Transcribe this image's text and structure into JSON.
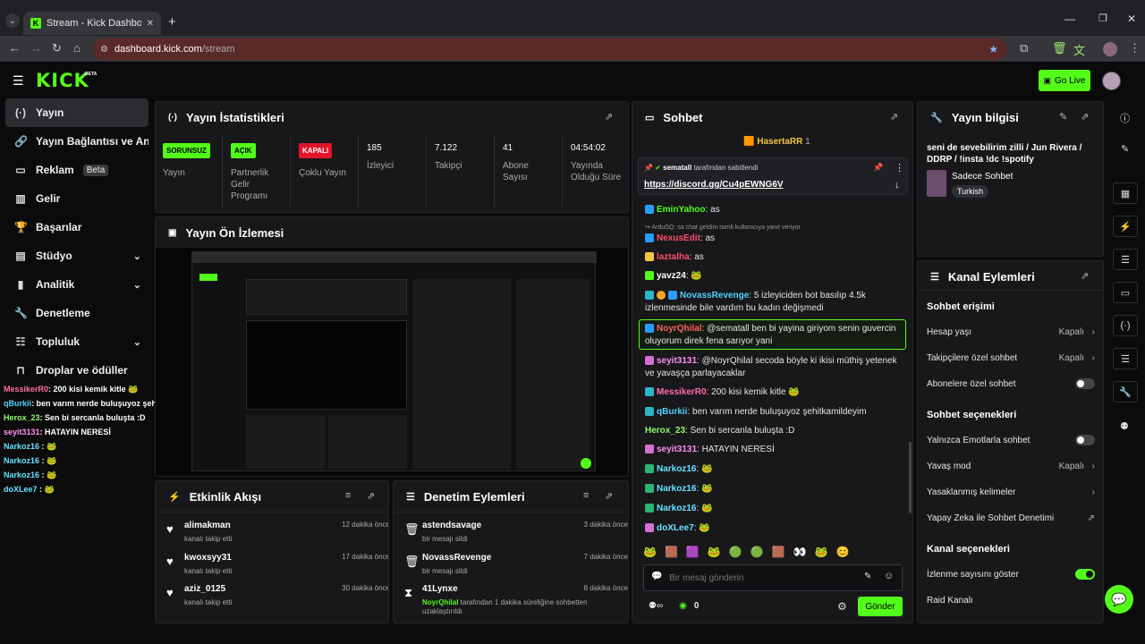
{
  "browser": {
    "tab_title": "Stream - Kick Dashboard",
    "url_domain": "dashboard.kick.com",
    "url_path": "/stream"
  },
  "header": {
    "logo": "KICK",
    "logo_beta": "BETA",
    "go_live": "Go Live"
  },
  "sidebar": {
    "items": [
      {
        "label": "Yayın",
        "icon": "broadcast-icon"
      },
      {
        "label": "Yayın Bağlantısı ve Anahtarı",
        "icon": "link-icon"
      },
      {
        "label": "Reklam",
        "icon": "ad-icon",
        "badge": "Beta"
      },
      {
        "label": "Gelir",
        "icon": "dollar-icon"
      },
      {
        "label": "Başarılar",
        "icon": "trophy-icon"
      },
      {
        "label": "Stüdyo",
        "icon": "studio-icon"
      },
      {
        "label": "Analitik",
        "icon": "chart-icon"
      },
      {
        "label": "Denetleme",
        "icon": "wrench-icon"
      },
      {
        "label": "Topluluk",
        "icon": "people-icon"
      },
      {
        "label": "Droplar ve ödüller",
        "icon": "gift-icon"
      }
    ]
  },
  "overlay_chat": [
    {
      "user": "MessikerR0",
      "text": ": 200 kisi kemik kitle",
      "color": "#ff6fa3"
    },
    {
      "user": "qBurkii",
      "text": ": ben varım nerde buluşuyoz şehitkamildeyim",
      "color": "#4fd1ff"
    },
    {
      "user": "Herox_23",
      "text": ": Sen bi sercanla buluşta :D",
      "color": "#8cff66"
    },
    {
      "user": "seyit3131",
      "text": ": HATAYIN NERESİ",
      "color": "#ff8ef0"
    },
    {
      "user": "Narkoz16",
      "text": " :",
      "color": "#66e0ff"
    },
    {
      "user": "Narkoz16",
      "text": " :",
      "color": "#66e0ff"
    },
    {
      "user": "Narkoz16",
      "text": " :",
      "color": "#66e0ff"
    },
    {
      "user": "doXLee7",
      "text": " :",
      "color": "#66e0ff"
    }
  ],
  "stats": {
    "title": "Yayın İstatistikleri",
    "cards": [
      {
        "badge": "SORUNSUZ",
        "label": "Yayın",
        "badge_color": "#53fc18"
      },
      {
        "badge": "AÇIK",
        "label": "Partnerlik Gelir Programı",
        "badge_color": "#53fc18"
      },
      {
        "badge": "KAPALI",
        "label": "Çoklu Yayın",
        "badge_color": "#e0142b"
      },
      {
        "value": "185",
        "label": "İzleyici"
      },
      {
        "value": "7.122",
        "label": "Takipçi"
      },
      {
        "value": "41",
        "label": "Abone Sayısı"
      },
      {
        "value": "04:54:02",
        "label": "Yayında Olduğu Süre"
      }
    ]
  },
  "preview": {
    "title": "Yayın Ön İzlemesi"
  },
  "activity": {
    "title": "Etkinlik Akışı",
    "items": [
      {
        "name": "alimakman",
        "sub": "kanalı takip etti",
        "time": "12 dakika önce"
      },
      {
        "name": "kwoxsyy31",
        "sub": "kanalı takip etti",
        "time": "17 dakika önce"
      },
      {
        "name": "aziz_0125",
        "sub": "kanalı takip etti",
        "time": "30 dakika önce"
      }
    ]
  },
  "moderation": {
    "title": "Denetim Eylemleri",
    "items": [
      {
        "name": "astendsavage",
        "sub": "bir mesajı sildi",
        "time": "3 dakika önce",
        "icon": "trash-icon"
      },
      {
        "name": "NovassRevenge",
        "sub": "bir mesajı sildi",
        "time": "7 dakika önce",
        "icon": "trash-icon"
      },
      {
        "name": "41Lynxe",
        "sub_user": "NoyrQhilal",
        "sub": " tarafından 1 dakika süreliğine sohbetten uzaklaştırıldı",
        "time": "8 dakika önce",
        "icon": "hourglass-icon"
      }
    ]
  },
  "chat": {
    "title": "Sohbet",
    "top_gifter": "HasertaRR",
    "top_gifter_count": "1",
    "pinned_by": "sematall",
    "pinned_suffix": " tarafından sabitlendi",
    "pinned_link": "https://discord.gg/Cu4pEWNG6V",
    "messages": [
      {
        "user": "EminYahoo",
        "text": ": as",
        "color": "#53fc18"
      },
      {
        "reply": "ArduSQ: sa chat geldim isimli kullanıcıya yanıt veriyor",
        "user": "NexusEdit",
        "text": ": as",
        "color": "#ff4d6a"
      },
      {
        "user": "laztalha",
        "text": ": as",
        "color": "#ff4d6a"
      },
      {
        "user": "yavz24",
        "text": ":",
        "color": "#53fc18"
      },
      {
        "user": "NovassRevenge",
        "text": ": 5 izleyiciden bot basılıp 4.5k izlenmesinde bile vardım bu kadın değişmedi",
        "color": "#4fd1ff"
      },
      {
        "user": "NoyrQhilal",
        "text": ": @sematall ben bi yayina giriyom senin guvercin oluyorum direk fena sarıyor yani",
        "color": "#ff6060"
      },
      {
        "user": "seyit3131",
        "text": ": @NoyrQhilal secoda böyle ki ikisi müthiş yetenek ve yavaşça parlayacaklar",
        "color": "#ff8ef0"
      },
      {
        "user": "MessikerR0",
        "text": ": 200 kisi kemik kitle",
        "color": "#ff6fa3"
      },
      {
        "user": "qBurkii",
        "text": ": ben varım nerde buluşuyoz şehitkamildeyim",
        "color": "#4fd1ff"
      },
      {
        "user": "Herox_23",
        "text": ": Sen bi sercanla buluşta :D",
        "color": "#8cff66"
      },
      {
        "user": "seyit3131",
        "text": ": HATAYIN NERESİ",
        "color": "#ff8ef0"
      },
      {
        "user": "Narkoz16",
        "text": ":",
        "color": "#66e0ff"
      },
      {
        "user": "Narkoz16",
        "text": ":",
        "color": "#66e0ff"
      },
      {
        "user": "Narkoz16",
        "text": ":",
        "color": "#66e0ff"
      },
      {
        "user": "doXLee7",
        "text": ":",
        "color": "#66e0ff"
      }
    ],
    "input_placeholder": "Bir mesaj gönderin",
    "send": "Gönder",
    "points": "0"
  },
  "stream_info": {
    "title": "Yayın bilgisi",
    "stream_title": "seni de sevebilirim zilli / Jun Rivera / DDRP / !insta !dc !spotify",
    "category": "Sadece Sohbet",
    "tag": "Turkish"
  },
  "channel_actions": {
    "title": "Kanal Eylemleri",
    "chat_access": "Sohbet erişimi",
    "account_age": "Hesap yaşı",
    "account_age_val": "Kapalı",
    "followers_only": "Takipçilere özel sohbet",
    "followers_only_val": "Kapalı",
    "subs_only": "Abonelere özel sohbet",
    "chat_options": "Sohbet seçenekleri",
    "emotes_only": "Yalnızca Emotlarla sohbet",
    "slow_mode": "Yavaş mod",
    "slow_mode_val": "Kapalı",
    "banned_words": "Yasaklanmış kelimeler",
    "ai_moderation": "Yapay Zeka ile Sohbet Denetimi",
    "channel_options": "Kanal seçenekleri",
    "show_viewers": "İzlenme sayısını göster",
    "raid": "Raid Kanalı"
  }
}
